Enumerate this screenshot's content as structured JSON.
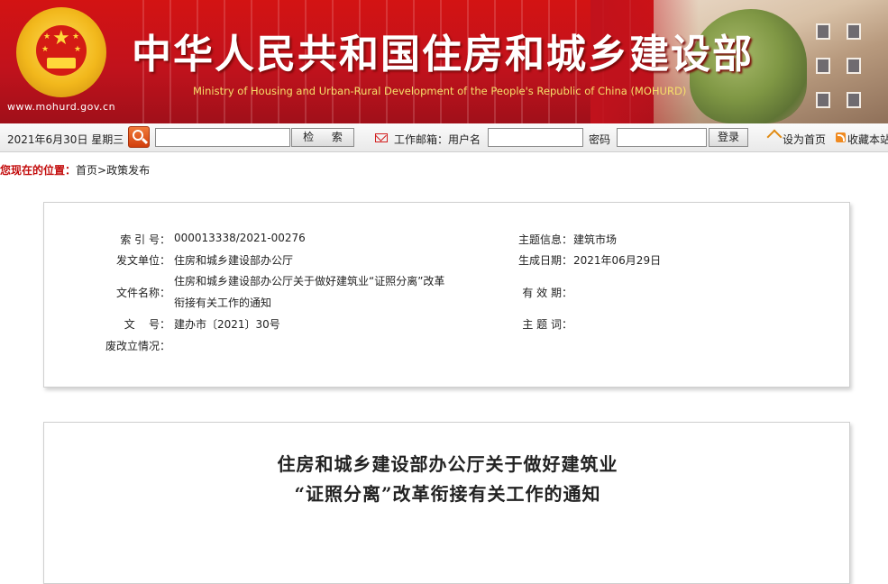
{
  "header": {
    "site_title": "中华人民共和国住房和城乡建设部",
    "site_subtitle": "Ministry of Housing and Urban-Rural Development of the People's Republic of China (MOHURD)",
    "site_url": "www.mohurd.gov.cn"
  },
  "toolbar": {
    "date": "2021年6月30日 星期三",
    "search_value": "",
    "search_button": "检  索",
    "mail_label": "工作邮箱：用户名",
    "username_value": "",
    "password_label": "密码",
    "password_value": "",
    "login_button": "登录",
    "set_home": "设为首页",
    "favorite": "收藏本站"
  },
  "breadcrumb": {
    "prefix": "您现在的位置：",
    "path": "首页>政策发布"
  },
  "info": {
    "index_label": "索 引 号：",
    "index_value": "000013338/2021-00276",
    "topic_label": "主题信息：",
    "topic_value": "建筑市场",
    "issuer_label": "发文单位：",
    "issuer_value": "住房和城乡建设部办公厅",
    "date_label": "生成日期：",
    "date_value": "2021年06月29日",
    "name_label": "文件名称：",
    "name_value_line1": "住房和城乡建设部办公厅关于做好建筑业“证照分离”改革",
    "name_value_line2": "衔接有关工作的通知",
    "validity_label": "有 效 期：",
    "validity_value": "",
    "docno_label": "文    号：",
    "docno_value": "建办市〔2021〕30号",
    "keywords_label": "主 题 词：",
    "keywords_value": "",
    "status_label": "废改立情况：",
    "status_value": ""
  },
  "article": {
    "title_line1": "住房和城乡建设部办公厅关于做好建筑业",
    "title_line2": "“证照分离”改革衔接有关工作的通知"
  }
}
